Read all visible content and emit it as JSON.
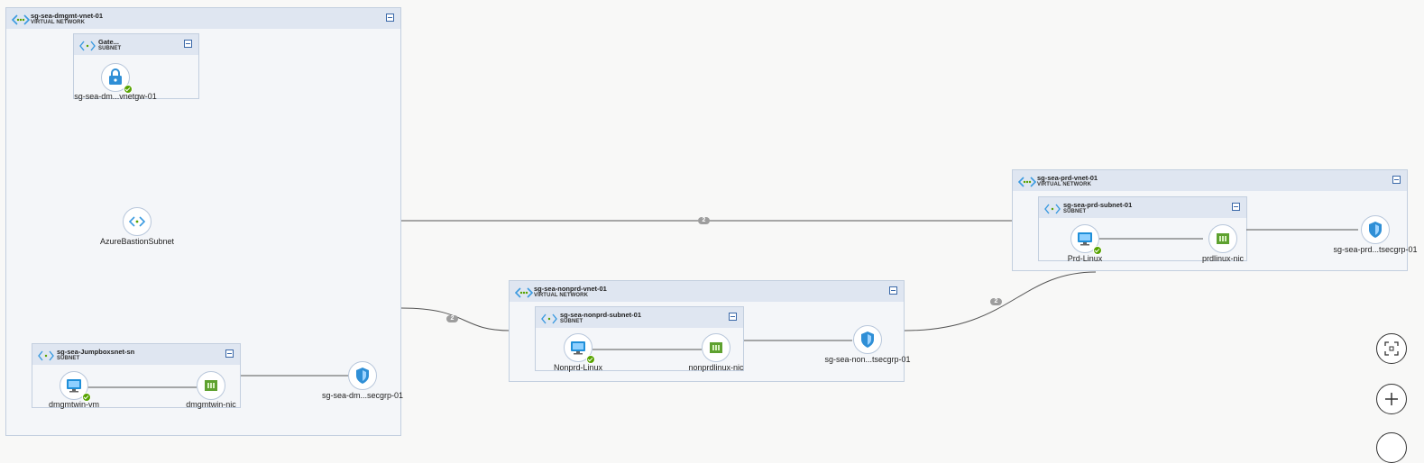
{
  "vnets": {
    "dmgmt": {
      "name": "sg-sea-dmgmt-vnet-01",
      "type": "VIRTUAL NETWORK"
    },
    "prd": {
      "name": "sg-sea-prd-vnet-01",
      "type": "VIRTUAL NETWORK"
    },
    "nonprd": {
      "name": "sg-sea-nonprd-vnet-01",
      "type": "VIRTUAL NETWORK"
    }
  },
  "subnets": {
    "gateway": {
      "name": "Gate...",
      "type": "SUBNET"
    },
    "jumpbox": {
      "name": "sg-sea-Jumpboxsnet-sn",
      "type": "SUBNET"
    },
    "prd": {
      "name": "sg-sea-prd-subnet-01",
      "type": "SUBNET"
    },
    "nonprd": {
      "name": "sg-sea-nonprd-subnet-01",
      "type": "SUBNET"
    }
  },
  "nodes": {
    "vnetgw": "sg-sea-dm...vnetgw-01",
    "bastion": "AzureBastionSubnet",
    "dmgmtwin_vm": "dmgmtwin-vm",
    "dmgmtwin_nic": "dmgmtwin-nic",
    "dmgmt_nsg": "sg-sea-dm...secgrp-01",
    "prd_vm": "Prd-Linux",
    "prd_nic": "prdlinux-nic",
    "prd_nsg": "sg-sea-prd...tsecgrp-01",
    "nonprd_vm": "Nonprd-Linux",
    "nonprd_nic": "nonprdlinux-nic",
    "nonprd_nsg": "sg-sea-non...tsecgrp-01"
  },
  "edges": {
    "peer_dmgmt_prd": "2",
    "peer_dmgmt_nonprd": "2",
    "peer_nonprd_prd": "2"
  },
  "icons": {
    "vnet": "virtual-network-icon",
    "subnet": "subnet-icon",
    "gateway": "vpn-gateway-icon",
    "vm": "virtual-machine-icon",
    "nic": "network-interface-icon",
    "nsg": "network-security-group-icon",
    "fit": "fit-to-screen-icon",
    "zoom_in": "zoom-in-icon"
  },
  "colors": {
    "accent": "#3a68a8",
    "status_ok": "#57a300",
    "nic": "#5ea12f",
    "vm": "#1f8fd9"
  }
}
